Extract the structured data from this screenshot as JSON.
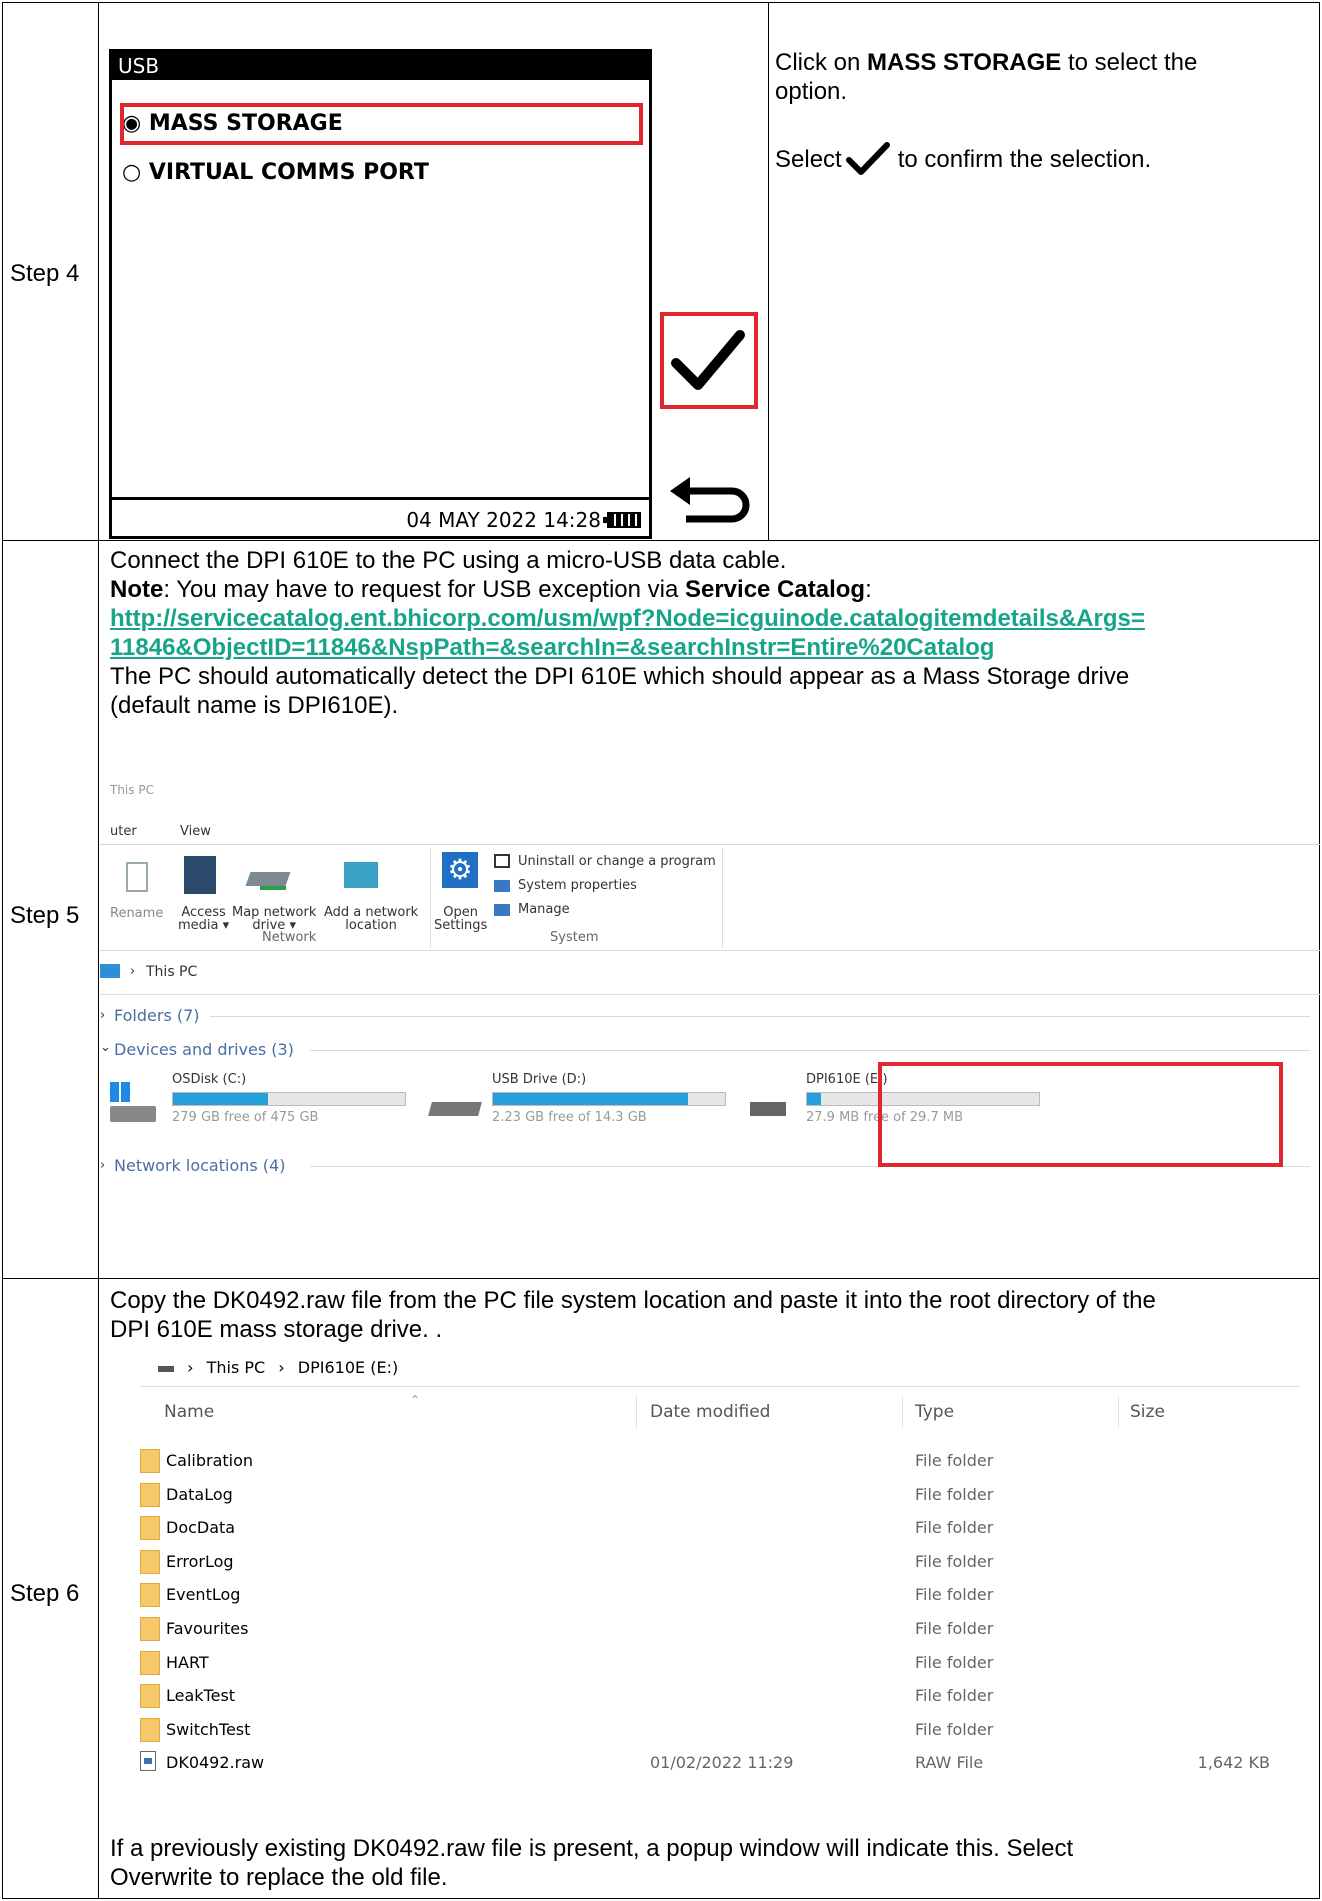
{
  "steps": {
    "step4": {
      "label": "Step 4"
    },
    "step5": {
      "label": "Step 5"
    },
    "step6": {
      "label": "Step 6"
    }
  },
  "device": {
    "title": "USB",
    "options": [
      "MASS STORAGE",
      "VIRTUAL COMMS PORT"
    ],
    "selected_index": 0,
    "status": "04 MAY 2022 14:28"
  },
  "step4_text": {
    "line1_pre": "Click on ",
    "line1_bold": "MASS STORAGE",
    "line1_post": " to select the",
    "line2": "option.",
    "select_pre": "Select ",
    "select_post": " to confirm the selection."
  },
  "step5_text": {
    "line1": "Connect the DPI 610E to the PC using a micro-USB data cable.",
    "note_label": "Note",
    "note_mid": ": You may have to request for USB exception via ",
    "note_bold": "Service Catalog",
    "note_end": ":",
    "link_line1": "http://servicecatalog.ent.bhicorp.com/usm/wpf?Node=icguinode.catalogitemdetails&Args=",
    "link_line2": "11846&ObjectID=11846&NspPath=&searchIn=&searchInstr=Entire%20Catalog",
    "detect_line1": "The PC should automatically detect the DPI 610E which should appear as a Mass Storage drive",
    "detect_line2": "(default name is DPI610E)."
  },
  "explorer": {
    "window_title": "This PC",
    "tabs": [
      "uter",
      "View"
    ],
    "ribbon": {
      "rename": "Rename",
      "access_media": [
        "Access",
        "media ▾"
      ],
      "map_network": [
        "Map network",
        "drive ▾"
      ],
      "add_network": [
        "Add a network",
        "location"
      ],
      "open_settings": [
        "Open",
        "Settings"
      ],
      "uninstall": "Uninstall or change a program",
      "system_props": "System properties",
      "manage": "Manage",
      "group_network": "Network",
      "group_system": "System"
    },
    "address": "This PC",
    "folders": "Folders (7)",
    "devices": "Devices and drives (3)",
    "network_locations": "Network locations (4)",
    "drives": [
      {
        "name": "OSDisk (C:)",
        "free": "279 GB free of 475 GB",
        "used_fraction": 0.41
      },
      {
        "name": "USB Drive (D:)",
        "free": "2.23 GB free of 14.3 GB",
        "used_fraction": 0.84
      },
      {
        "name": "DPI610E (E:)",
        "free": "27.9 MB free of 29.7 MB",
        "used_fraction": 0.06
      }
    ]
  },
  "step6_text": {
    "line1": "Copy the DK0492.raw file from the PC file system location and paste it into the root directory of the",
    "line2": "DPI 610E mass storage drive. .",
    "footer1": "If a previously existing DK0492.raw file is present, a popup window will indicate this. Select",
    "footer2": "Overwrite to replace the old file."
  },
  "filelist": {
    "breadcrumb": [
      "This PC",
      "DPI610E (E:)"
    ],
    "headers": {
      "name": "Name",
      "date": "Date modified",
      "type": "Type",
      "size": "Size"
    },
    "rows": [
      {
        "name": "Calibration",
        "date": "",
        "type": "File folder",
        "size": ""
      },
      {
        "name": "DataLog",
        "date": "",
        "type": "File folder",
        "size": ""
      },
      {
        "name": "DocData",
        "date": "",
        "type": "File folder",
        "size": ""
      },
      {
        "name": "ErrorLog",
        "date": "",
        "type": "File folder",
        "size": ""
      },
      {
        "name": "EventLog",
        "date": "",
        "type": "File folder",
        "size": ""
      },
      {
        "name": "Favourites",
        "date": "",
        "type": "File folder",
        "size": ""
      },
      {
        "name": "HART",
        "date": "",
        "type": "File folder",
        "size": ""
      },
      {
        "name": "LeakTest",
        "date": "",
        "type": "File folder",
        "size": ""
      },
      {
        "name": "SwitchTest",
        "date": "",
        "type": "File folder",
        "size": ""
      },
      {
        "name": "DK0492.raw",
        "date": "01/02/2022 11:29",
        "type": "RAW File",
        "size": "1,642 KB"
      }
    ]
  },
  "colors": {
    "highlight": "#e0262f",
    "link": "#17a589",
    "drive_bar": "#26a0da"
  }
}
